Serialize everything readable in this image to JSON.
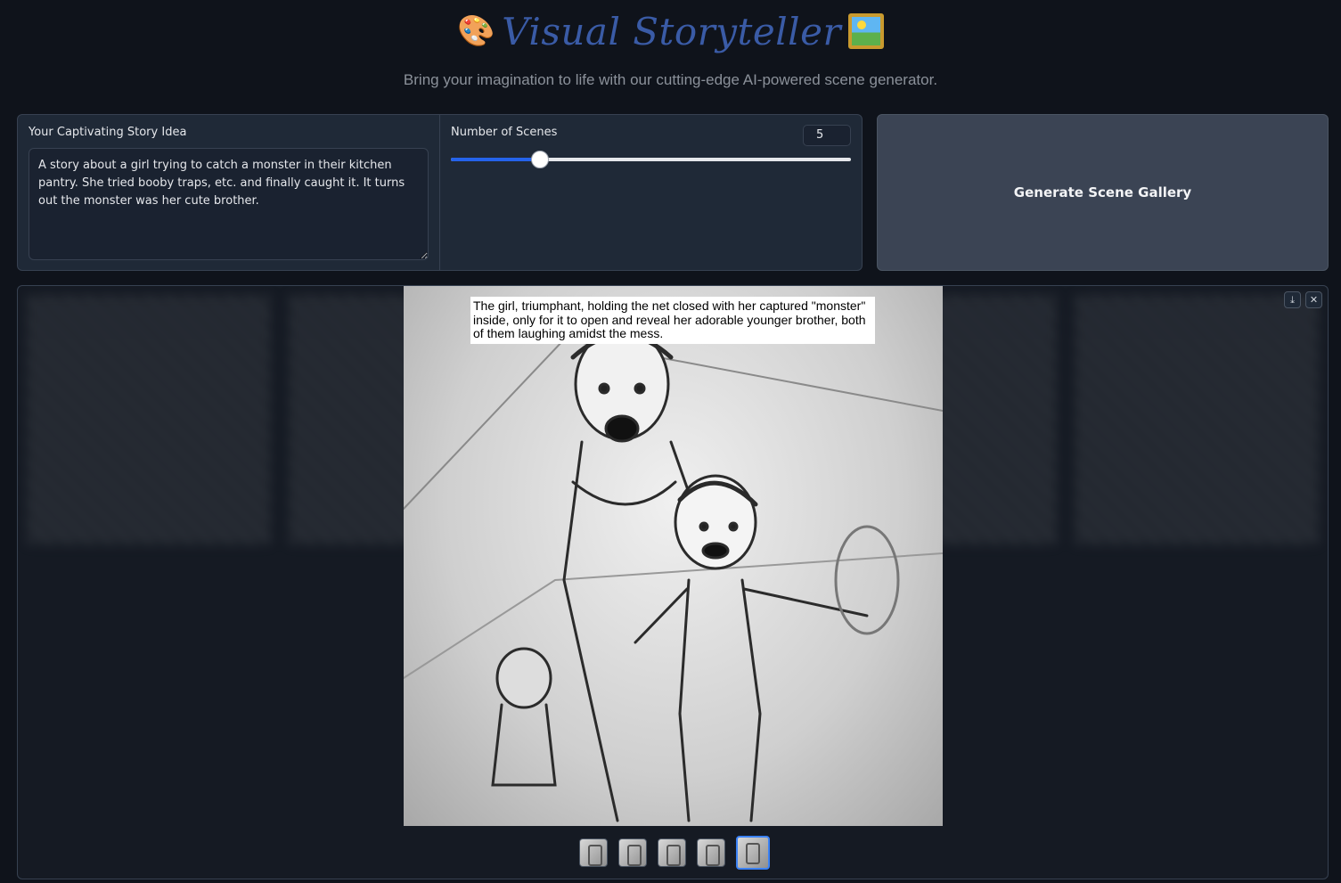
{
  "header": {
    "title": "Visual Storyteller",
    "palette_emoji": "🎨",
    "subtitle": "Bring your imagination to life with our cutting-edge AI-powered scene generator."
  },
  "story": {
    "label": "Your Captivating Story Idea",
    "value": "A story about a girl trying to catch a monster in their kitchen pantry. She tried booby traps, etc. and finally caught it. It turns out the monster was her cute brother."
  },
  "scenes": {
    "label": "Number of Scenes",
    "value": "5",
    "slider_fraction": 0.222
  },
  "generate": {
    "label": "Generate Scene Gallery"
  },
  "gallery": {
    "caption": "The girl, triumphant, holding the net closed with her captured \"monster\" inside, only for it to open and reveal her adorable younger brother, both of them laughing amidst the mess.",
    "download_icon": "download-icon",
    "close_icon": "close-icon",
    "thumbnail_count": 5,
    "selected_index": 5
  },
  "colors": {
    "background": "#0f131b",
    "panel": "#1f2937",
    "accent": "#2563eb",
    "title": "#3a5ba6"
  }
}
